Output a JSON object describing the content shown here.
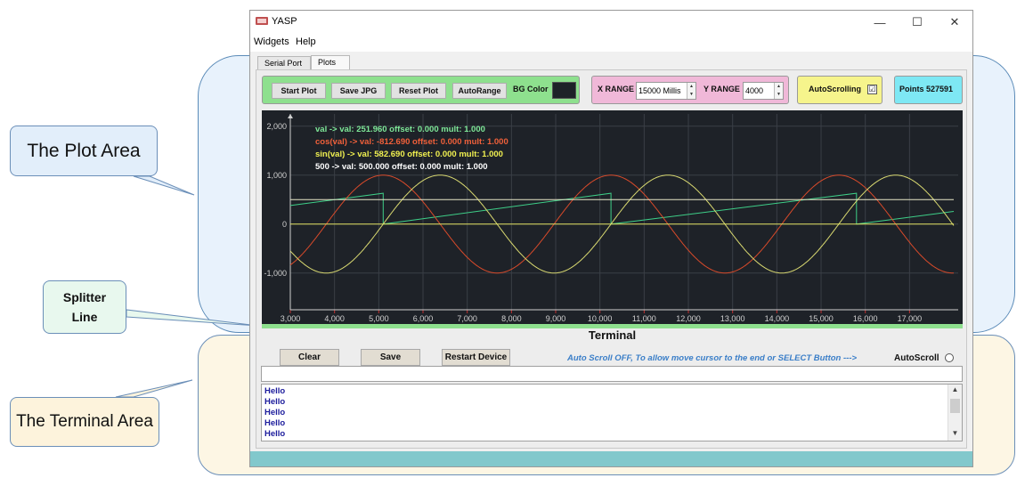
{
  "annotations": {
    "plot_area": "The Plot Area",
    "splitter_line": "Splitter Line",
    "terminal_area": "The Terminal Area"
  },
  "window": {
    "title": "YASP",
    "controls": {
      "minimize": "—",
      "maximize": "☐",
      "close": "✕"
    }
  },
  "menu": [
    {
      "label": "Widgets"
    },
    {
      "label": "Help"
    }
  ],
  "tabs": [
    {
      "label": "Serial Port",
      "active": false
    },
    {
      "label": "Plots",
      "active": true
    }
  ],
  "toolbar": {
    "start_plot": "Start Plot",
    "save_jpg": "Save JPG",
    "reset_plot": "Reset Plot",
    "autorange": "AutoRange",
    "bg_color_label": "BG Color",
    "bg_color": "#1e2228",
    "x_range_label": "X RANGE",
    "x_range_value": "15000 Millis",
    "y_range_label": "Y RANGE",
    "y_range_value": "4000",
    "autoscrolling_label": "AutoScrolling",
    "autoscrolling_checked": "☑",
    "points_label": "Points 527591"
  },
  "chart_data": {
    "type": "line",
    "x_ticks": [
      "3,000",
      "4,000",
      "5,000",
      "6,000",
      "7,000",
      "8,000",
      "9,000",
      "10,000",
      "11,000",
      "12,000",
      "13,000",
      "14,000",
      "15,000",
      "16,000",
      "17,000"
    ],
    "y_ticks": [
      "2,000",
      "1,000",
      "0",
      "-1,000"
    ],
    "xlim": [
      3000,
      18100
    ],
    "ylim": [
      -1750,
      2250
    ],
    "background": "#1e2228",
    "legend": [
      {
        "text": "val ->  val: 251.960 offset: 0.000 mult: 1.000",
        "color": "#7ee898"
      },
      {
        "text": "cos(val) ->  val: -812.690 offset: 0.000 mult: 1.000",
        "color": "#f0603a"
      },
      {
        "text": "sin(val) ->  val: 582.690 offset: 0.000 mult: 1.000",
        "color": "#f0f050"
      },
      {
        "text": "500 ->  val: 500.000 offset: 0.000 mult: 1.000",
        "color": "#ffffff"
      }
    ],
    "series": [
      {
        "name": "val",
        "color": "#3ecf88",
        "kind": "sawtooth",
        "x": [
          3000,
          5100,
          5100,
          10250,
          10250,
          15800,
          15800,
          18000
        ],
        "y": [
          380,
          630,
          0,
          630,
          0,
          630,
          0,
          260
        ]
      },
      {
        "name": "cos(val)",
        "color": "#d84a2a",
        "kind": "cos",
        "x_start": 3000,
        "x_end": 18000,
        "amplitude": 1000,
        "phase_zero_x": 5100,
        "period": 5150
      },
      {
        "name": "sin(val)",
        "color": "#d8d870",
        "kind": "sin",
        "x_start": 3000,
        "x_end": 18000,
        "amplitude": 1000,
        "phase_zero_x": 5100,
        "period": 5150
      },
      {
        "name": "500",
        "color": "#e8e8c8",
        "kind": "constant",
        "x": [
          3000,
          18000
        ],
        "y": [
          500,
          500
        ]
      },
      {
        "name": "zero",
        "color": "#e0e060",
        "kind": "constant",
        "x": [
          3000,
          18000
        ],
        "y": [
          0,
          0
        ]
      }
    ]
  },
  "terminal": {
    "title": "Terminal",
    "clear": "Clear",
    "save": "Save",
    "restart_device": "Restart Device",
    "autoscroll_message": "Auto Scroll OFF, To allow move cursor to the end or SELECT Button --->",
    "autoscroll_label": "AutoScroll",
    "input_value": "",
    "lines": [
      "Hello",
      "Hello",
      "Hello",
      "Hello",
      "Hello"
    ],
    "scroll_up": "▲",
    "scroll_down": "▼"
  }
}
